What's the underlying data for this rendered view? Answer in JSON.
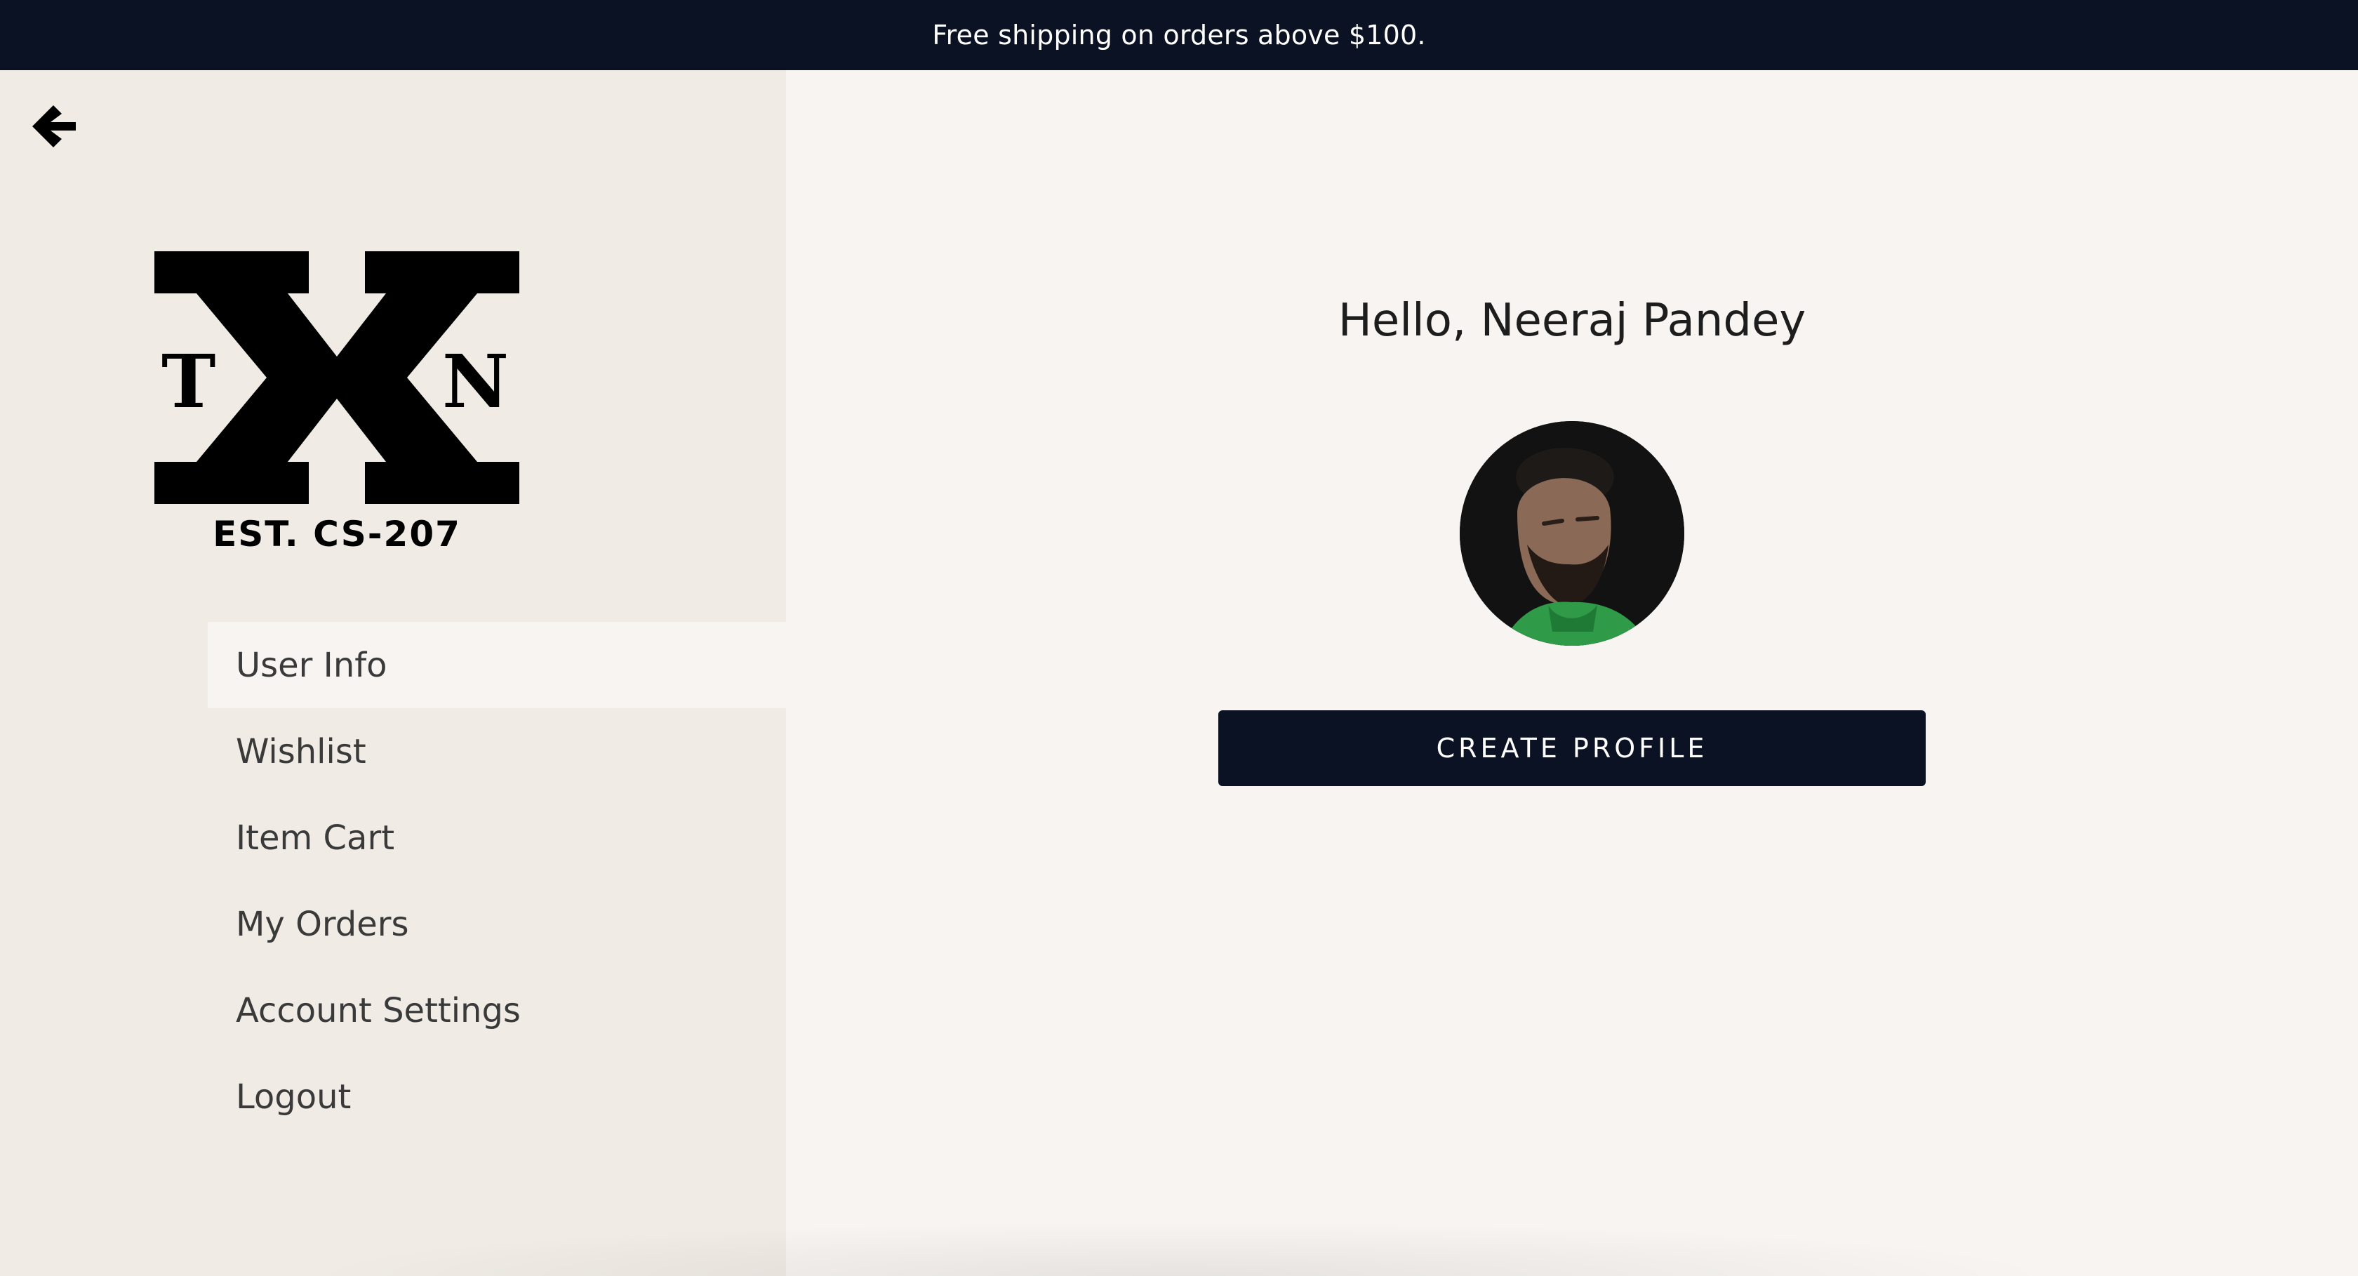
{
  "promo": {
    "text": "Free shipping on orders above $100."
  },
  "header": {
    "back_icon": "arrow-left-icon"
  },
  "logo": {
    "letter_left": "T",
    "letter_right": "N",
    "tagline": "EST. CS-207"
  },
  "sidebar": {
    "items": [
      {
        "label": "User Info",
        "active": true
      },
      {
        "label": "Wishlist",
        "active": false
      },
      {
        "label": "Item Cart",
        "active": false
      },
      {
        "label": "My Orders",
        "active": false
      },
      {
        "label": "Account Settings",
        "active": false
      },
      {
        "label": "Logout",
        "active": false
      }
    ]
  },
  "main": {
    "greeting": "Hello, Neeraj Pandey",
    "create_profile_label": "CREATE PROFILE"
  },
  "colors": {
    "accent_dark": "#0b1224",
    "sidebar_bg": "#f0ebe5",
    "page_bg": "#f7f4f1"
  }
}
